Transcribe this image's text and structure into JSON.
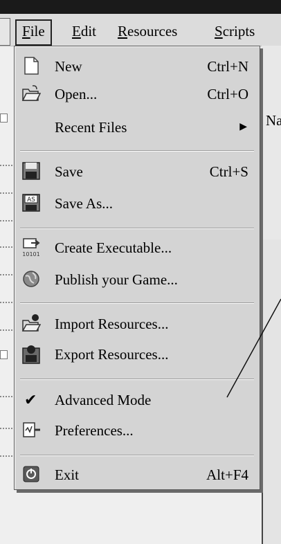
{
  "menubar": {
    "items": [
      {
        "label": "File",
        "accel": "F",
        "rest": "ile"
      },
      {
        "label": "Edit",
        "accel": "E",
        "rest": "dit"
      },
      {
        "label": "Resources",
        "accel": "R",
        "rest": "esources"
      },
      {
        "label": "Scripts",
        "accel": "S",
        "rest": "cripts"
      }
    ]
  },
  "right_fragment": {
    "text": "Na"
  },
  "menu": {
    "new": {
      "label": "New",
      "shortcut": "Ctrl+N",
      "icon": "new-file-icon"
    },
    "open": {
      "label": "Open...",
      "shortcut": "Ctrl+O",
      "icon": "open-folder-icon"
    },
    "recent": {
      "label": "Recent Files",
      "arrow": "▶"
    },
    "save": {
      "label": "Save",
      "shortcut": "Ctrl+S",
      "icon": "floppy-icon"
    },
    "save_as": {
      "label": "Save As...",
      "icon": "save-as-icon",
      "icon_text": "AS"
    },
    "create_exe": {
      "label": "Create Executable...",
      "icon": "executable-icon",
      "icon_text": "10101"
    },
    "publish": {
      "label": "Publish your Game...",
      "icon": "globe-icon"
    },
    "import": {
      "label": "Import Resources...",
      "icon": "import-folder-icon"
    },
    "export": {
      "label": "Export Resources...",
      "icon": "export-icon"
    },
    "advanced": {
      "label": "Advanced Mode",
      "checked": true,
      "check": "✔"
    },
    "preferences": {
      "label": "Preferences...",
      "icon": "preferences-icon"
    },
    "exit": {
      "label": "Exit",
      "shortcut": "Alt+F4",
      "icon": "exit-icon"
    }
  }
}
